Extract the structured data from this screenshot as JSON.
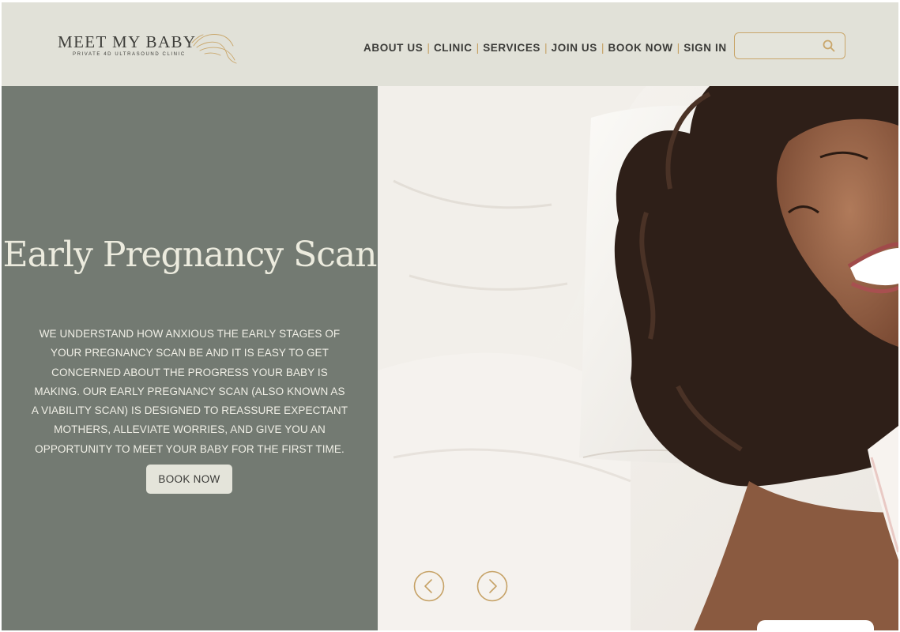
{
  "brand": {
    "name": "MEET MY BABY",
    "tagline": "PRIVATE 4D ULTRASOUND CLINIC"
  },
  "nav": {
    "items": [
      "ABOUT US",
      "CLINIC",
      "SERVICES",
      "JOIN US",
      "BOOK NOW",
      "SIGN IN"
    ]
  },
  "search": {
    "value": "",
    "placeholder": ""
  },
  "hero": {
    "title": "Early Pregnancy Scan",
    "body": "WE UNDERSTAND HOW ANXIOUS THE EARLY STAGES OF YOUR PREGNANCY SCAN BE AND IT IS EASY TO GET CONCERNED ABOUT THE PROGRESS YOUR BABY IS MAKING. OUR EARLY PREGNANCY SCAN (ALSO KNOWN AS A VIABILITY SCAN) IS DESIGNED TO REASSURE EXPECTANT MOTHERS, ALLEVIATE WORRIES, AND GIVE YOU AN OPPORTUNITY TO MEET YOUR BABY FOR THE FIRST TIME.",
    "button": "BOOK NOW"
  },
  "carousel": {
    "prev_icon": "chevron-left-icon",
    "next_icon": "chevron-right-icon"
  },
  "colors": {
    "header_bg": "#e1e1d8",
    "panel_bg": "#737a72",
    "accent_gold": "#c6a266",
    "text_dark": "#3b3b38"
  }
}
